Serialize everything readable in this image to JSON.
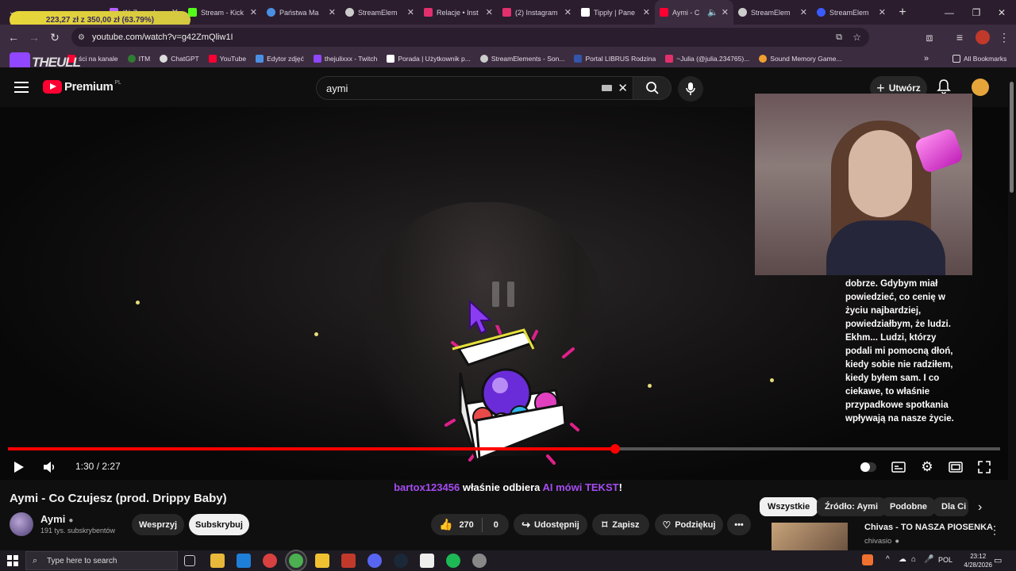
{
  "overlay": {
    "goal_text": "223,27 zł z 350,00 zł (63.79%)",
    "logo_text": "THEULL"
  },
  "tabs": [
    {
      "title": "(1) Zarządz",
      "color": "#b561ff"
    },
    {
      "title": "Stream - Kick",
      "color": "#53fc18"
    },
    {
      "title": "Państwa Ma",
      "color": "#4a90e2"
    },
    {
      "title": "StreamElem",
      "color": "#cccccc"
    },
    {
      "title": "Relacje • Inst",
      "color": "#e1306c"
    },
    {
      "title": "(2) Instagram",
      "color": "#e1306c"
    },
    {
      "title": "Tipply | Pane",
      "color": "#ffffff"
    },
    {
      "title": "Aymi - C",
      "color": "#ff0033"
    },
    {
      "title": "StreamElem",
      "color": "#cccccc"
    },
    {
      "title": "StreamElem",
      "color": "#3a5bff"
    }
  ],
  "address": {
    "url": "youtube.com/watch?v=g42ZmQliw1I"
  },
  "bookmarks": [
    {
      "label": "ści na kanale",
      "color": "#ff0033"
    },
    {
      "label": "ITM",
      "color": "#2e7d32"
    },
    {
      "label": "ChatGPT",
      "color": "#dddddd"
    },
    {
      "label": "YouTube",
      "color": "#ff0033"
    },
    {
      "label": "Edytor zdjęć",
      "color": "#4a90e2"
    },
    {
      "label": "thejulixxx - Twitch",
      "color": "#9146ff"
    },
    {
      "label": "Porada | Użytkownik p...",
      "color": "#ffffff"
    },
    {
      "label": "StreamElements - Son...",
      "color": "#cccccc"
    },
    {
      "label": "Portal LIBRUS Rodzina",
      "color": "#3355aa"
    },
    {
      "label": "~Julia (@julia.234765)...",
      "color": "#e1306c"
    },
    {
      "label": "Sound Memory Game...",
      "color": "#f0a030"
    }
  ],
  "all_bookmarks": "All Bookmarks",
  "youtube": {
    "logo": "Premium",
    "country": "PL",
    "search_value": "aymi",
    "create_label": "Utwórz"
  },
  "caption": "dobrze. Gdybym miał powiedzieć, co cenię w życiu najbardziej, powiedziałbym, że ludzi. Ekhm... Ludzi, którzy podali mi pomocną dłoń, kiedy sobie nie radziłem, kiedy byłem sam. I co ciekawe, to właśnie przypadkowe spotkania wpływają na nasze życie.",
  "player": {
    "time": "1:30 / 2:27",
    "progress": 0.612
  },
  "alert": {
    "user": "bartox123456",
    "middle": " właśnie odbiera ",
    "prize": "AI mówi TEKST",
    "end": "!"
  },
  "video": {
    "title": "Aymi - Co Czujesz (prod. Drippy Baby)"
  },
  "channel": {
    "name": "Aymi",
    "subs": "191 tys. subskrybentów",
    "support": "Wesprzyj",
    "subscribe": "Subskrybuj"
  },
  "actions": {
    "likes": "270",
    "dislikes": "0",
    "share": "Udostępnij",
    "save": "Zapisz",
    "thanks": "Podziękuj"
  },
  "chips": [
    "Wszystkie",
    "Źródło: Aymi",
    "Podobne",
    "Dla Ci"
  ],
  "recommendation": {
    "title": "Chivas - TO NASZA PIOSENKA",
    "channel": "chivasio"
  },
  "taskbar": {
    "search_placeholder": "Type here to search",
    "lang": "POL",
    "time": "23:12",
    "date": "4/28/2026"
  }
}
